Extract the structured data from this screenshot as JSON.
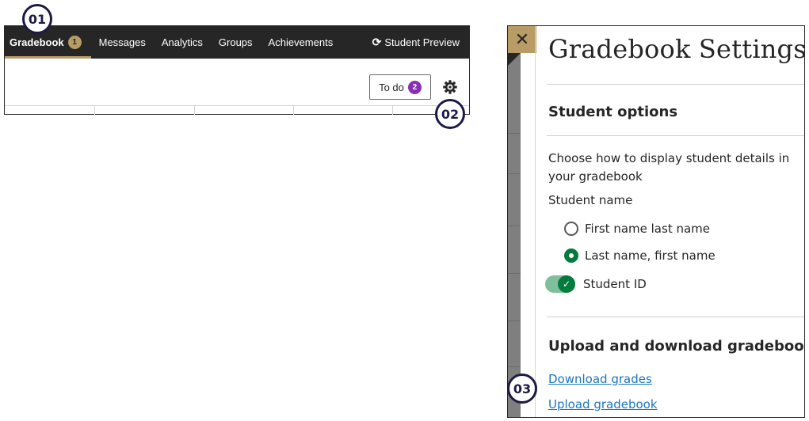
{
  "steps": [
    "01",
    "02",
    "03"
  ],
  "nav": {
    "tabs": [
      {
        "label": "Gradebook",
        "badge": "1"
      },
      {
        "label": "Messages"
      },
      {
        "label": "Analytics"
      },
      {
        "label": "Groups"
      },
      {
        "label": "Achievements"
      }
    ],
    "student_preview": "Student Preview"
  },
  "toolbar": {
    "todo_label": "To do",
    "todo_count": "2"
  },
  "settings": {
    "title": "Gradebook Settings",
    "student_options": {
      "heading": "Student options",
      "description": "Choose how to display student details in your gradebook",
      "name_label": "Student name",
      "options": [
        {
          "label": "First name last name",
          "checked": false
        },
        {
          "label": "Last name, first name",
          "checked": true
        }
      ],
      "student_id_label": "Student ID",
      "student_id_on": true
    },
    "upload_download": {
      "heading": "Upload and download gradebook",
      "download_link": "Download grades",
      "upload_link": "Upload gradebook"
    }
  },
  "colors": {
    "accent": "#b89b65",
    "dark": "#262626",
    "success": "#037b3d",
    "link": "#1b75bb",
    "todo_badge": "#8a2fb5"
  },
  "icons": {
    "close": "close-icon",
    "gear": "gear-icon",
    "preview": "refresh-icon",
    "check": "check-icon"
  }
}
